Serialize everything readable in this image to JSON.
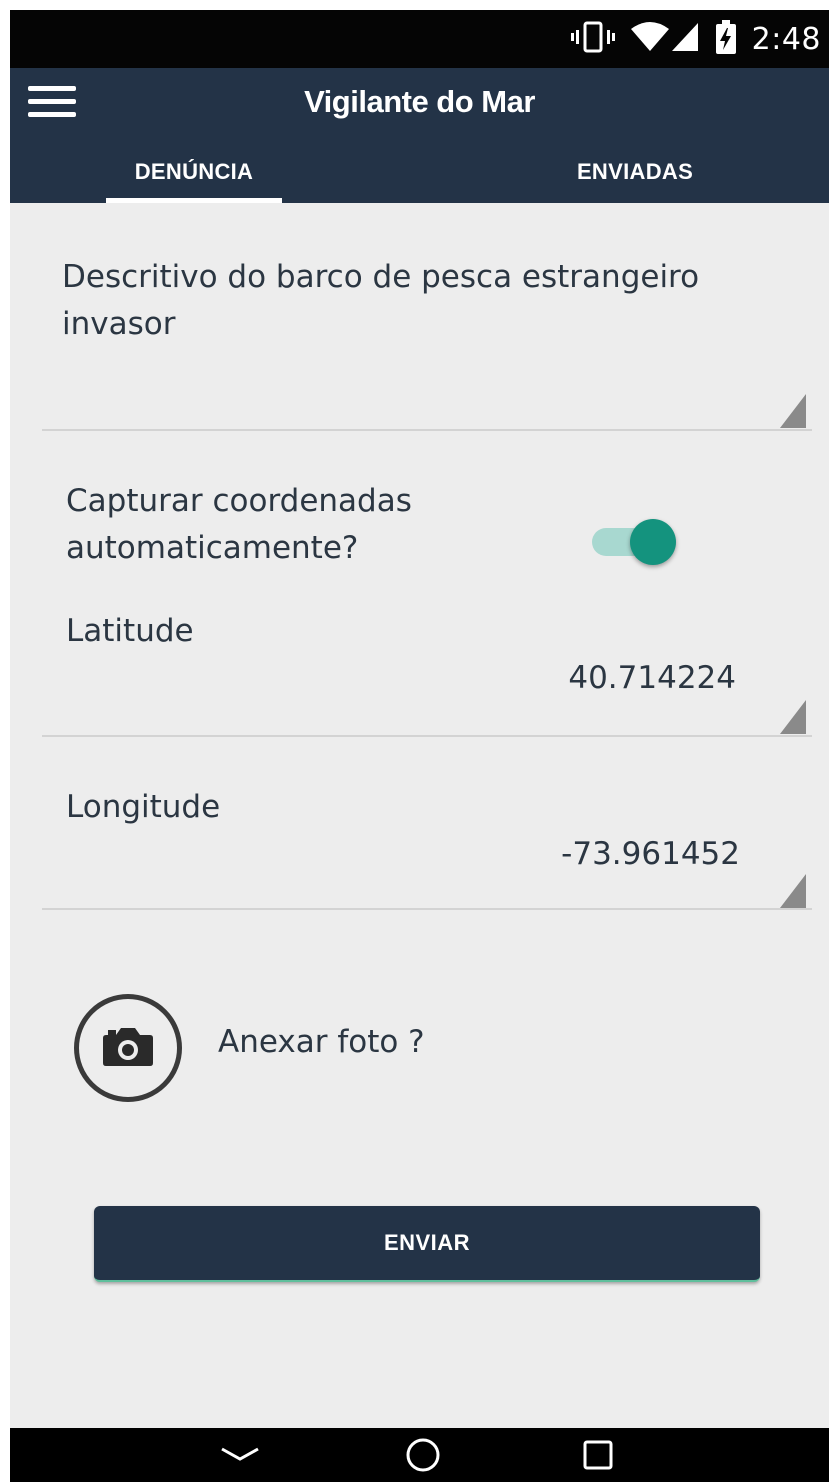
{
  "status_bar": {
    "time": "2:48",
    "icons": [
      "vibrate-icon",
      "wifi-icon",
      "signal-icon",
      "battery-icon"
    ]
  },
  "app_bar": {
    "title": "Vigilante do Mar",
    "menu_icon": "hamburger-menu-icon"
  },
  "tabs": [
    {
      "label": "DENÚNCIA",
      "selected": true
    },
    {
      "label": "ENVIADAS",
      "selected": false
    }
  ],
  "form": {
    "description": {
      "label": "Descritivo do barco de pesca estrangeiro invasor",
      "value": ""
    },
    "auto_coordinates": {
      "label": "Capturar coordenadas automaticamente?",
      "enabled": true
    },
    "latitude": {
      "label": "Latitude",
      "value": "40.714224"
    },
    "longitude": {
      "label": "Longitude",
      "value": "-73.961452"
    },
    "attach_photo": {
      "label": "Anexar foto ?",
      "icon": "camera-icon"
    },
    "submit_label": "ENVIAR"
  },
  "nav_bar": {
    "buttons": [
      "back-icon",
      "home-icon",
      "recents-icon"
    ]
  },
  "colors": {
    "primary": "#233347",
    "accent": "#14937e",
    "accent_light": "#a8d8d0",
    "background": "#ededed",
    "text": "#2b3642"
  }
}
